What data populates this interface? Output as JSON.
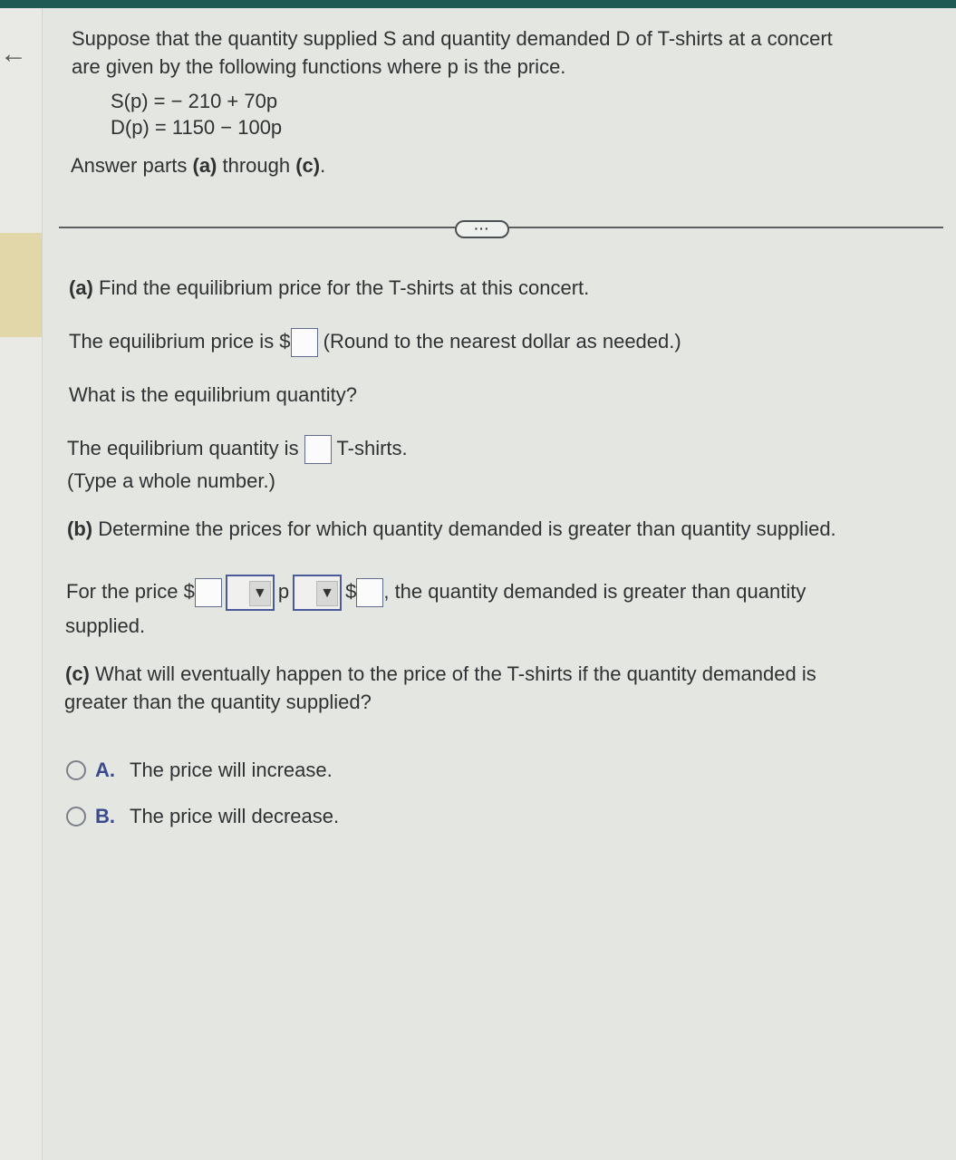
{
  "nav": {
    "back_icon": "←"
  },
  "problem": {
    "intro_line1": "Suppose that the quantity supplied S and quantity demanded D of T-shirts at a concert",
    "intro_line2": "are given by the following functions where p is the price.",
    "supply_eq": "S(p) = − 210 + 70p",
    "demand_eq": "D(p) = 1150 − 100p",
    "instr_pre": "Answer parts ",
    "instr_a": "(a)",
    "instr_mid": " through ",
    "instr_c": "(c)",
    "instr_end": "."
  },
  "divider": {
    "more_label": "···"
  },
  "part_a": {
    "label": "(a)",
    "question": " Find the equilibrium price for the T-shirts at this concert.",
    "price_pre": "The equilibrium price is $",
    "price_value": "",
    "price_hint": "(Round to the nearest dollar as needed.)",
    "qty_question": "What is the equilibrium quantity?",
    "qty_pre": "The equilibrium quantity is",
    "qty_value": "",
    "qty_post": "T-shirts.",
    "qty_hint": "(Type a whole number.)"
  },
  "part_b": {
    "label": "(b)",
    "question": " Determine the prices for which quantity demanded is greater than quantity supplied.",
    "pre": "For the price $",
    "low_value": "",
    "dropdown1_value": "",
    "var": "p",
    "dropdown2_value": "",
    "dollar": "$",
    "high_value": "",
    "post": ", the quantity demanded is greater than quantity",
    "post2": "supplied."
  },
  "part_c": {
    "label": "(c)",
    "question_l1": " What will eventually happen to the price of the T-shirts if the quantity demanded is",
    "question_l2": "greater than the quantity supplied?",
    "options": [
      {
        "letter": "A.",
        "text": "The price will increase."
      },
      {
        "letter": "B.",
        "text": "The price will decrease."
      }
    ]
  }
}
